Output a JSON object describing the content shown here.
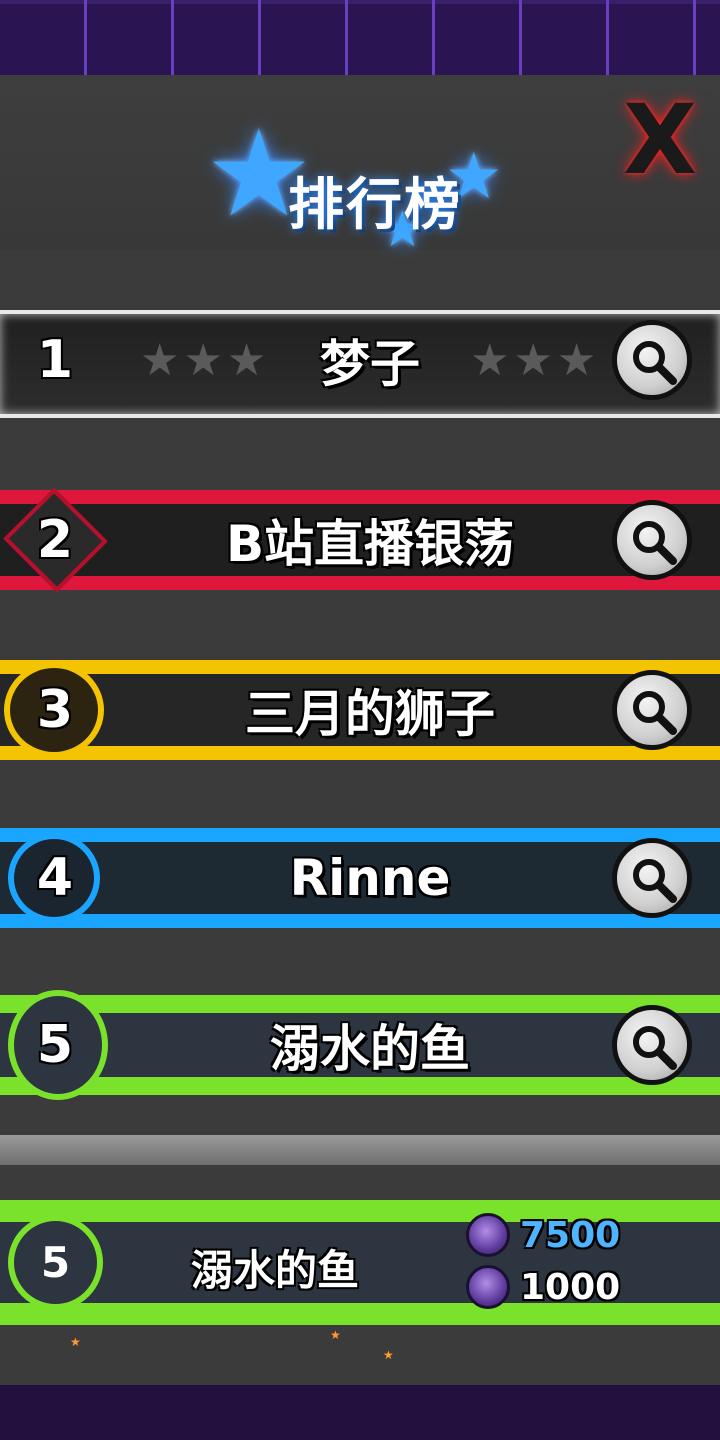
{
  "header": {
    "title": "排行榜",
    "close_label": "X"
  },
  "leaderboard": [
    {
      "rank": "1",
      "name": "梦子"
    },
    {
      "rank": "2",
      "name": "B站直播银荡"
    },
    {
      "rank": "3",
      "name": "三月的狮子"
    },
    {
      "rank": "4",
      "name": "Rinne"
    },
    {
      "rank": "5",
      "name": "溺水的鱼"
    }
  ],
  "self": {
    "rank": "5",
    "name": "溺水的鱼",
    "score_primary": "7500",
    "score_secondary": "1000"
  },
  "colors": {
    "rank1": "#d9d9d9",
    "rank2": "#e0173c",
    "rank3": "#f5c400",
    "rank4": "#1aa6ff",
    "rank5": "#7ae22b",
    "score_primary": "#4fb4ff",
    "score_secondary": "#ffffff"
  },
  "icons": {
    "close": "close-x-icon",
    "search": "magnifier-icon",
    "resource_primary": "purple-medal-icon",
    "resource_secondary": "purple-gem-icon"
  }
}
